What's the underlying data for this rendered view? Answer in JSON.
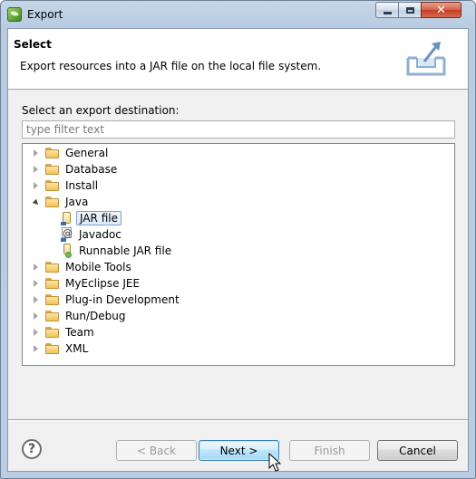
{
  "window": {
    "title": "Export"
  },
  "header": {
    "title": "Select",
    "description": "Export resources into a JAR file on the local file system.",
    "illustration_icon": "export-illustration-icon"
  },
  "destination": {
    "label": "Select an export destination:",
    "filter_placeholder": "type filter text",
    "filter_value": ""
  },
  "tree": {
    "items": [
      {
        "label": "General",
        "level": 0,
        "expanded": false,
        "icon": "folder-icon"
      },
      {
        "label": "Database",
        "level": 0,
        "expanded": false,
        "icon": "folder-icon"
      },
      {
        "label": "Install",
        "level": 0,
        "expanded": false,
        "icon": "folder-icon"
      },
      {
        "label": "Java",
        "level": 0,
        "expanded": true,
        "icon": "folder-icon"
      },
      {
        "label": "JAR file",
        "level": 1,
        "selected": true,
        "icon": "jar-file-icon"
      },
      {
        "label": "Javadoc",
        "level": 1,
        "icon": "javadoc-icon"
      },
      {
        "label": "Runnable JAR file",
        "level": 1,
        "icon": "runnable-jar-icon"
      },
      {
        "label": "Mobile Tools",
        "level": 0,
        "expanded": false,
        "icon": "folder-icon"
      },
      {
        "label": "MyEclipse JEE",
        "level": 0,
        "expanded": false,
        "icon": "folder-icon"
      },
      {
        "label": "Plug-in Development",
        "level": 0,
        "expanded": false,
        "icon": "folder-icon"
      },
      {
        "label": "Run/Debug",
        "level": 0,
        "expanded": false,
        "icon": "folder-icon"
      },
      {
        "label": "Team",
        "level": 0,
        "expanded": false,
        "icon": "folder-icon"
      },
      {
        "label": "XML",
        "level": 0,
        "expanded": false,
        "icon": "folder-icon"
      }
    ]
  },
  "buttons": {
    "back": "< Back",
    "next": "Next >",
    "finish": "Finish",
    "cancel": "Cancel",
    "help_glyph": "?"
  },
  "colors": {
    "title_bar": "#b9cce3",
    "close_button": "#c23d24",
    "selection_border": "#7da2ce",
    "default_button_border": "#3c7fb1"
  }
}
